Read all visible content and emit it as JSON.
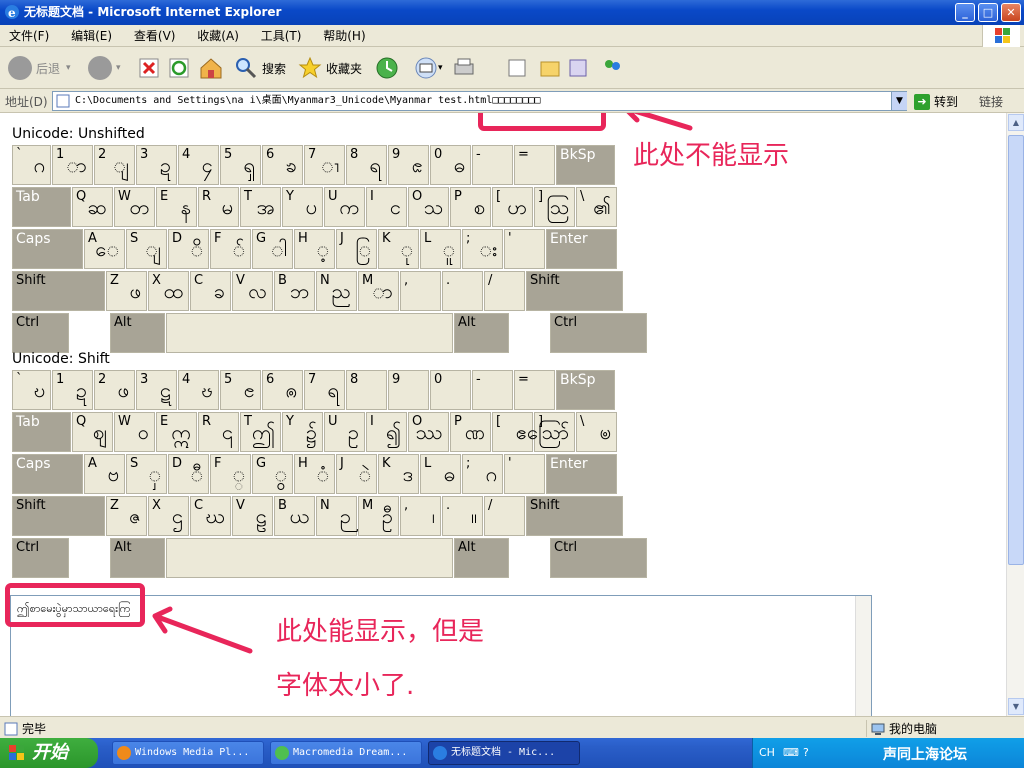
{
  "window": {
    "title": "无标题文档 - Microsoft Internet Explorer",
    "min": "_",
    "max": "□",
    "close": "✕"
  },
  "menu": [
    "文件(F)",
    "编辑(E)",
    "查看(V)",
    "收藏(A)",
    "工具(T)",
    "帮助(H)"
  ],
  "toolbar": {
    "back": "后退",
    "search": "搜索",
    "favorites": "收藏夹"
  },
  "address": {
    "label": "地址(D)",
    "value": "C:\\Documents and Settings\\na i\\桌面\\Myanmar3_Unicode\\Myanmar test.html□□□□□□□□",
    "go": "转到",
    "links": "链接"
  },
  "keyboards": [
    {
      "title": "Unicode: Unshifted",
      "rows": [
        [
          {
            "k": "`",
            "m": "ဂ"
          },
          {
            "k": "1",
            "m": "ာ"
          },
          {
            "k": "2",
            "m": "ျ"
          },
          {
            "k": "3",
            "m": "ဍ"
          },
          {
            "k": "4",
            "m": "၄"
          },
          {
            "k": "5",
            "m": "ၡ"
          },
          {
            "k": "6",
            "m": "ၶ"
          },
          {
            "k": "7",
            "m": "ၢ"
          },
          {
            "k": "8",
            "m": "ရ"
          },
          {
            "k": "9",
            "m": "ၕ"
          },
          {
            "k": "0",
            "m": "ဓ"
          },
          {
            "k": "-",
            "m": ""
          },
          {
            "k": "=",
            "m": ""
          },
          {
            "k": "BkSp",
            "m": "",
            "dark": true
          }
        ],
        [
          {
            "k": "Tab",
            "m": "",
            "dark": true
          },
          {
            "k": "Q",
            "m": "ဆ"
          },
          {
            "k": "W",
            "m": "တ"
          },
          {
            "k": "E",
            "m": "န"
          },
          {
            "k": "R",
            "m": "မ"
          },
          {
            "k": "T",
            "m": "အ"
          },
          {
            "k": "Y",
            "m": "ပ"
          },
          {
            "k": "U",
            "m": "က"
          },
          {
            "k": "I",
            "m": "င"
          },
          {
            "k": "O",
            "m": "သ"
          },
          {
            "k": "P",
            "m": "စ"
          },
          {
            "k": "[",
            "m": "ဟ"
          },
          {
            "k": "]",
            "m": "ဩ"
          },
          {
            "k": "\\",
            "m": "၏"
          }
        ],
        [
          {
            "k": "Caps",
            "m": "",
            "dark": true
          },
          {
            "k": "A",
            "m": "ေ"
          },
          {
            "k": "S",
            "m": "ျ"
          },
          {
            "k": "D",
            "m": "ိ"
          },
          {
            "k": "F",
            "m": "်"
          },
          {
            "k": "G",
            "m": "ါ"
          },
          {
            "k": "H",
            "m": "့"
          },
          {
            "k": "J",
            "m": "ြ"
          },
          {
            "k": "K",
            "m": "ု"
          },
          {
            "k": "L",
            "m": "ူ"
          },
          {
            "k": ";",
            "m": "း"
          },
          {
            "k": "'",
            "m": ""
          },
          {
            "k": "Enter",
            "m": "",
            "dark": true
          }
        ],
        [
          {
            "k": "Shift",
            "m": "",
            "mod": true
          },
          {
            "k": "Z",
            "m": "ဖ"
          },
          {
            "k": "X",
            "m": "ထ"
          },
          {
            "k": "C",
            "m": "ခ"
          },
          {
            "k": "V",
            "m": "လ"
          },
          {
            "k": "B",
            "m": "ဘ"
          },
          {
            "k": "N",
            "m": "ည"
          },
          {
            "k": "M",
            "m": "ာ"
          },
          {
            "k": ",",
            "m": ""
          },
          {
            "k": ".",
            "m": ""
          },
          {
            "k": "/",
            "m": ""
          },
          {
            "k": "Shift",
            "m": "",
            "mod": true
          }
        ],
        [
          {
            "k": "Ctrl",
            "m": "",
            "mod": true
          },
          {
            "k": "Alt",
            "m": "",
            "mod": true
          },
          {
            "k": "",
            "m": ""
          },
          {
            "k": "Alt",
            "m": "",
            "mod": true
          },
          {
            "k": "Ctrl",
            "m": "",
            "mod": true
          }
        ]
      ]
    },
    {
      "title": "Unicode: Shift",
      "rows": [
        [
          {
            "k": "`",
            "m": "ဎ"
          },
          {
            "k": "1",
            "m": "ဍ"
          },
          {
            "k": "2",
            "m": "ဖ"
          },
          {
            "k": "3",
            "m": "ဋ"
          },
          {
            "k": "4",
            "m": "ၓ"
          },
          {
            "k": "5",
            "m": "ၔ"
          },
          {
            "k": "6",
            "m": "ၐ"
          },
          {
            "k": "7",
            "m": "ရ"
          },
          {
            "k": "8",
            "m": ""
          },
          {
            "k": "9",
            "m": ""
          },
          {
            "k": "0",
            "m": ""
          },
          {
            "k": "-",
            "m": ""
          },
          {
            "k": "=",
            "m": ""
          },
          {
            "k": "BkSp",
            "m": "",
            "dark": true
          }
        ],
        [
          {
            "k": "Tab",
            "m": "",
            "dark": true
          },
          {
            "k": "Q",
            "m": "ဈ"
          },
          {
            "k": "W",
            "m": "ဝ"
          },
          {
            "k": "E",
            "m": "ဣ"
          },
          {
            "k": "R",
            "m": "၎"
          },
          {
            "k": "T",
            "m": "ဤ"
          },
          {
            "k": "Y",
            "m": "၌"
          },
          {
            "k": "U",
            "m": "ဥ"
          },
          {
            "k": "I",
            "m": "၍"
          },
          {
            "k": "O",
            "m": "ဿ"
          },
          {
            "k": "P",
            "m": "ဏ"
          },
          {
            "k": "[",
            "m": "ဧ"
          },
          {
            "k": "]",
            "m": "ဪ"
          },
          {
            "k": "\\",
            "m": "ၑ"
          }
        ],
        [
          {
            "k": "Caps",
            "m": "",
            "dark": true
          },
          {
            "k": "A",
            "m": "ဗ"
          },
          {
            "k": "S",
            "m": "ှ"
          },
          {
            "k": "D",
            "m": "ီ"
          },
          {
            "k": "F",
            "m": "္"
          },
          {
            "k": "G",
            "m": "ွ"
          },
          {
            "k": "H",
            "m": "ံ"
          },
          {
            "k": "J",
            "m": "ဲ"
          },
          {
            "k": "K",
            "m": "ဒ"
          },
          {
            "k": "L",
            "m": "ဓ"
          },
          {
            "k": ";",
            "m": "ဂ"
          },
          {
            "k": "'",
            "m": ""
          },
          {
            "k": "Enter",
            "m": "",
            "dark": true
          }
        ],
        [
          {
            "k": "Shift",
            "m": "",
            "mod": true
          },
          {
            "k": "Z",
            "m": "ဇ"
          },
          {
            "k": "X",
            "m": "ဌ"
          },
          {
            "k": "C",
            "m": "ဃ"
          },
          {
            "k": "V",
            "m": "ဠ"
          },
          {
            "k": "B",
            "m": "ယ"
          },
          {
            "k": "N",
            "m": "ဉ"
          },
          {
            "k": "M",
            "m": "ဦ"
          },
          {
            "k": ",",
            "m": "၊"
          },
          {
            "k": ".",
            "m": "။"
          },
          {
            "k": "/",
            "m": ""
          },
          {
            "k": "Shift",
            "m": "",
            "mod": true
          }
        ],
        [
          {
            "k": "Ctrl",
            "m": "",
            "mod": true
          },
          {
            "k": "Alt",
            "m": "",
            "mod": true
          },
          {
            "k": "",
            "m": ""
          },
          {
            "k": "Alt",
            "m": "",
            "mod": true
          },
          {
            "k": "Ctrl",
            "m": "",
            "mod": true
          }
        ]
      ]
    }
  ],
  "textarea_value": "ဤစာမေးပွဲမှာသာယာရေးကြ",
  "annotations": {
    "top": "此处不能显示",
    "bottom_line1": "此处能显示，但是",
    "bottom_line2": "字体太小了."
  },
  "status": {
    "done": "完毕",
    "zone": "我的电脑"
  },
  "taskbar": {
    "start": "开始",
    "tasks": [
      "Windows Media Pl...",
      "Macromedia Dream...",
      "无标题文档 - Mic..."
    ],
    "tray": "CH",
    "tray_brand": "声同上海论坛"
  }
}
